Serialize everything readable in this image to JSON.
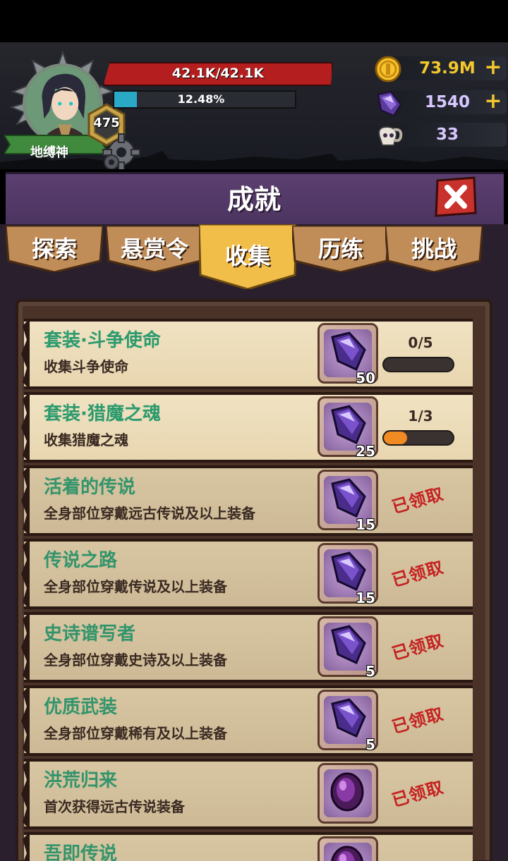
{
  "player": {
    "name": "地缚神",
    "level": "475",
    "hp_text": "42.1K/42.1K",
    "xp_text": "12.48%",
    "xp_fraction": 0.1248
  },
  "resources": [
    {
      "name": "gold",
      "value": "73.9M",
      "color": "#f3c82e",
      "has_plus": true
    },
    {
      "name": "crystal",
      "value": "1540",
      "color": "#d7c8ff",
      "has_plus": true
    },
    {
      "name": "ram-skull",
      "value": "33",
      "color": "#d7c8ff",
      "has_plus": false
    }
  ],
  "title": "成就",
  "tabs": [
    {
      "label": "探索",
      "active": false
    },
    {
      "label": "悬赏令",
      "active": false
    },
    {
      "label": "收集",
      "active": true
    },
    {
      "label": "历练",
      "active": false
    },
    {
      "label": "挑战",
      "active": false
    }
  ],
  "achievements": [
    {
      "title": "套装·斗争使命",
      "desc": "收集斗争使命",
      "reward_icon": "crystal-icon",
      "reward_count": "50",
      "status": "in_progress",
      "progress_text": "0/5",
      "progress": 0.0
    },
    {
      "title": "套装·猎魔之魂",
      "desc": "收集猎魔之魂",
      "reward_icon": "crystal-icon",
      "reward_count": "25",
      "status": "in_progress",
      "progress_text": "1/3",
      "progress": 0.333
    },
    {
      "title": "活着的传说",
      "desc": "全身部位穿戴远古传说及以上装备",
      "reward_icon": "crystal-icon",
      "reward_count": "15",
      "status": "claimed",
      "claimed_text": "已领取"
    },
    {
      "title": "传说之路",
      "desc": "全身部位穿戴传说及以上装备",
      "reward_icon": "crystal-icon",
      "reward_count": "15",
      "status": "claimed",
      "claimed_text": "已领取"
    },
    {
      "title": "史诗谱写者",
      "desc": "全身部位穿戴史诗及以上装备",
      "reward_icon": "crystal-icon",
      "reward_count": "5",
      "status": "claimed",
      "claimed_text": "已领取"
    },
    {
      "title": "优质武装",
      "desc": "全身部位穿戴稀有及以上装备",
      "reward_icon": "crystal-icon",
      "reward_count": "5",
      "status": "claimed",
      "claimed_text": "已领取"
    },
    {
      "title": "洪荒归来",
      "desc": "首次获得远古传说装备",
      "reward_icon": "purple-gem-icon",
      "reward_count": "",
      "status": "claimed",
      "claimed_text": "已领取"
    },
    {
      "title": "吾即传说",
      "desc": "",
      "reward_icon": "purple-gem-icon",
      "reward_count": "",
      "status": "claimed",
      "claimed_text": ""
    }
  ]
}
